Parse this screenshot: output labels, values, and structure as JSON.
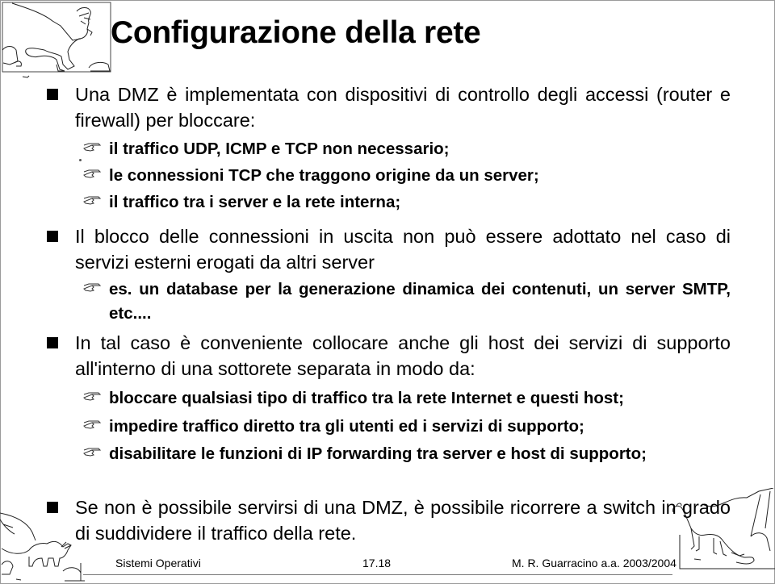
{
  "slide": {
    "title": "Configurazione della rete",
    "items": [
      {
        "level": 1,
        "text": "Una DMZ è implementata con dispositivi di controllo degli accessi (router e firewall) per bloccare:",
        "subitems": [
          "il traffico UDP, ICMP e TCP non necessario;",
          "le connessioni TCP che traggono origine da un server;",
          "il traffico tra i server e la rete interna;"
        ]
      },
      {
        "level": 1,
        "text": "Il blocco delle connessioni in uscita non può essere adottato nel caso di servizi esterni erogati da altri server",
        "subitems": [
          "es. un database per la generazione dinamica dei contenuti, un server SMTP, etc...."
        ]
      },
      {
        "level": 1,
        "text": "In tal caso è conveniente collocare anche gli host dei servizi di supporto all'interno di una sottorete separata in modo da:",
        "subitems": [
          "bloccare qualsiasi tipo di traffico tra la rete Internet e questi host;",
          "impedire traffico diretto tra gli utenti ed i servizi di supporto;",
          "disabilitare le funzioni di IP forwarding tra server e host di supporto;"
        ]
      },
      {
        "level": 1,
        "text": "Se non è possibile servirsi di una DMZ, è possibile ricorrere a switch in grado di suddividere il traffico della rete.",
        "subitems": []
      }
    ]
  },
  "icons": {
    "level1_bullet": "square-bullet-icon",
    "level2_bullet": "pointing-hand-icon",
    "clipart": [
      "t-rex-clipart",
      "triceratops-clipart",
      "brontosaurus-clipart"
    ]
  },
  "footer": {
    "course": "Sistemi Operativi",
    "page_number": "17.18",
    "author": "M. R. Guarracino a.a. 2003/2004"
  }
}
